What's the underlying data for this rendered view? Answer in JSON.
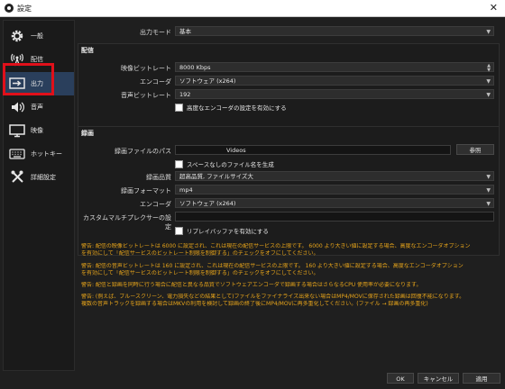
{
  "window": {
    "title": "設定",
    "close_glyph": "✕"
  },
  "sidebar": {
    "items": [
      {
        "label": "一般",
        "icon": "gear-icon"
      },
      {
        "label": "配信",
        "icon": "broadcast-icon"
      },
      {
        "label": "出力",
        "icon": "output-icon",
        "active": true
      },
      {
        "label": "音声",
        "icon": "speaker-icon"
      },
      {
        "label": "映像",
        "icon": "monitor-icon"
      },
      {
        "label": "ホットキー",
        "icon": "keyboard-icon"
      },
      {
        "label": "詳細設定",
        "icon": "tools-icon"
      }
    ]
  },
  "output_mode": {
    "label": "出力モード",
    "value": "基本"
  },
  "streaming": {
    "title": "配信",
    "video_bitrate_label": "映像ビットレート",
    "video_bitrate_value": "8000 Kbps",
    "encoder_label": "エンコーダ",
    "encoder_value": "ソフトウェア (x264)",
    "audio_bitrate_label": "音声ビットレート",
    "audio_bitrate_value": "192",
    "advanced_encoder_checkbox": "高度なエンコーダの設定を有効にする"
  },
  "recording": {
    "title": "録画",
    "path_label": "録画ファイルのパス",
    "path_value": "Videos",
    "browse_button": "参照",
    "no_space_checkbox": "スペースなしのファイル名を生成",
    "quality_label": "録画品質",
    "quality_value": "超高品質, ファイルサイズ大",
    "format_label": "録画フォーマット",
    "format_value": "mp4",
    "encoder_label": "エンコーダ",
    "encoder_value": "ソフトウェア (x264)",
    "muxer_label": "カスタムマルチプレクサーの設定",
    "muxer_value": "",
    "replay_checkbox": "リプレイバッファを有効にする"
  },
  "warnings": [
    "警告: 配信の映像ビットレートは 6000 に設定され、これは現在の配信サービスの上限です。 6000 より大きい値に設定する場合、高度なエンコーダオプション",
    "を有効にして「配信サービスのビットレート制限を制御する」のチェックをオフにしてください。",
    "警告: 配信の音声ビットレートは 160 に設定され、これは現在の配信サービスの上限です。 160 より大きい値に設定する場合、高度なエンコーダオプション",
    "を有効にして「配信サービスのビットレート制限を制御する」のチェックをオフにしてください。",
    "警告: 配信と録画を同時に行う場合に配信と異なる品質でソフトウェアエンコーダで録画する場合はさらなるCPU 使用率が必要になります。",
    "警告: (例えば、ブルースクリーン、電力損失などの結果として)ファイルをファイナライズ出来ない場合はMP4/MOVに保存された録画は回復不能になります。",
    "複数の音声トラックを録画する場合はMKVの利用を検討して録画の終了後にMP4/MOVに再多重化してください。(ファイル → 録画の再多重化)"
  ],
  "footer": {
    "ok": "OK",
    "cancel": "キャンセル",
    "apply": "適用"
  },
  "colors": {
    "accent_warning": "#e8a51a",
    "highlight_box": "#e0101a",
    "active_item": "#2a3f5c"
  }
}
